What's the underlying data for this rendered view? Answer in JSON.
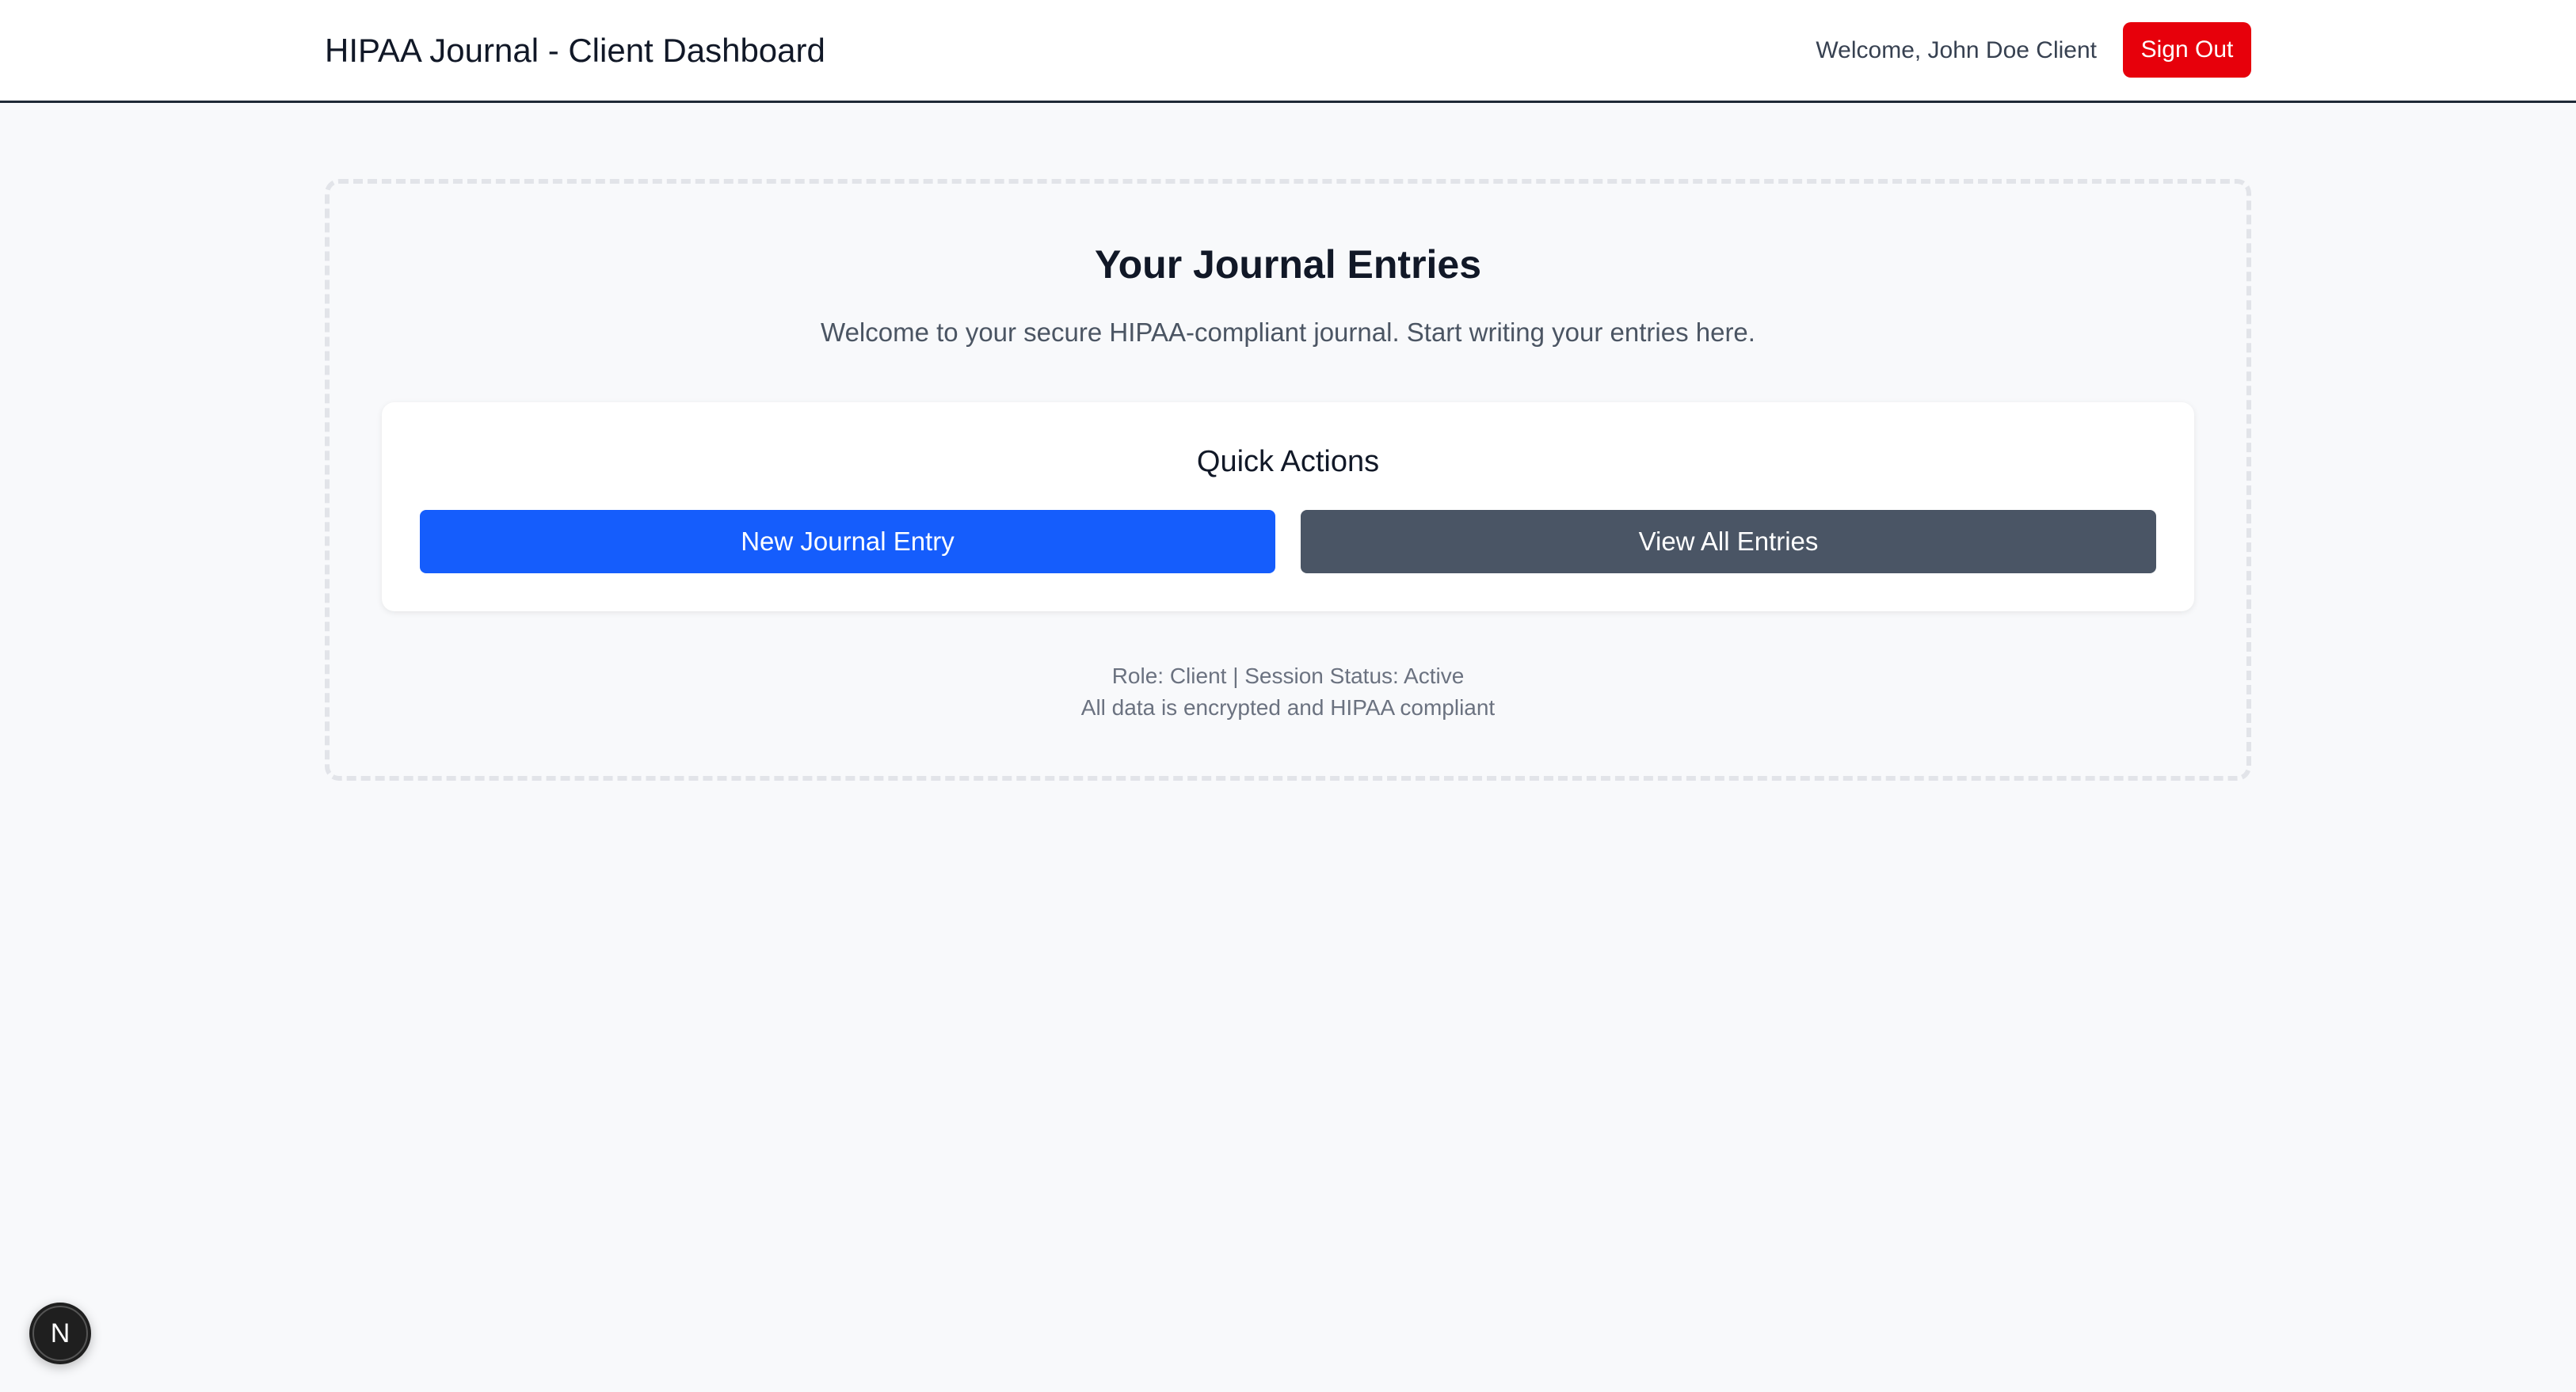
{
  "header": {
    "title": "HIPAA Journal - Client Dashboard",
    "welcome_text": "Welcome, John Doe Client",
    "sign_out_label": "Sign Out"
  },
  "main": {
    "title": "Your Journal Entries",
    "subtitle": "Welcome to your secure HIPAA-compliant journal. Start writing your entries here.",
    "quick_actions": {
      "title": "Quick Actions",
      "new_entry_label": "New Journal Entry",
      "view_all_label": "View All Entries"
    },
    "footer": {
      "status_line": "Role: Client | Session Status: Active",
      "compliance_line": "All data is encrypted and HIPAA compliant"
    }
  },
  "dev_indicator": {
    "label": "N",
    "icon": "nextjs-dev-tools-icon"
  },
  "colors": {
    "sign_out": "#e7000b",
    "primary_button": "#155dfc",
    "secondary_button": "#4a5565",
    "page_background": "#f8f9fb"
  }
}
